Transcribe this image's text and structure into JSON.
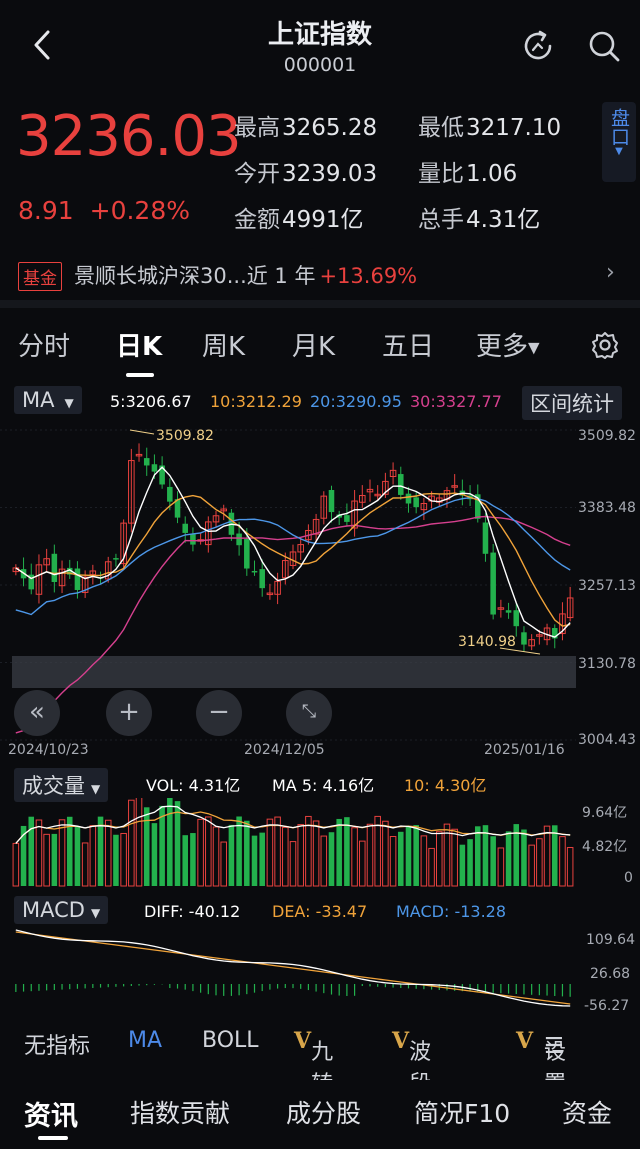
{
  "header": {
    "title": "上证指数",
    "code": "000001"
  },
  "quote": {
    "price": "3236.03",
    "change": "8.91",
    "change_pct": "+0.28%",
    "high_label": "最高",
    "high": "3265.28",
    "low_label": "最低",
    "low": "3217.10",
    "open_label": "今开",
    "open": "3239.03",
    "vol_ratio_label": "量比",
    "vol_ratio": "1.06",
    "amount_label": "金额",
    "amount": "4991亿",
    "turnover_label": "总手",
    "turnover": "4.31亿",
    "pankou": "盘口"
  },
  "fund": {
    "badge": "基金",
    "name": "景顺长城沪深30...近 1 年",
    "ret": "+13.69%"
  },
  "tabs": [
    "分时",
    "日K",
    "周K",
    "月K",
    "五日",
    "更多"
  ],
  "ma_bar": {
    "selector": "MA",
    "ma5": "5:3206.67",
    "ma10": "10:3212.29",
    "ma20": "20:3290.95",
    "ma30": "30:3327.77",
    "stats_button": "区间统计"
  },
  "kline": {
    "y_ticks": [
      "3509.82",
      "3383.48",
      "3257.13",
      "3130.78",
      "3004.43"
    ],
    "x_ticks": [
      "2024/10/23",
      "2024/12/05",
      "2025/01/16"
    ],
    "high_mark": "3509.82",
    "low_mark": "3140.98"
  },
  "volume_bar": {
    "selector": "成交量",
    "vol": "VOL: 4.31亿",
    "ma5": "MA 5: 4.16亿",
    "ma10": "10: 4.30亿",
    "y_ticks": [
      "9.64亿",
      "4.82亿",
      "0"
    ]
  },
  "macd_bar": {
    "selector": "MACD",
    "diff": "DIFF: -40.12",
    "dea": "DEA: -33.47",
    "macd": "MACD: -13.28",
    "y_ticks": [
      "109.64",
      "26.68",
      "-56.27"
    ]
  },
  "indicators": [
    "无指标",
    "MA",
    "BOLL",
    "九转",
    "波段王",
    "设置"
  ],
  "bottom_tabs": [
    "资讯",
    "指数贡献",
    "成分股",
    "简况F10",
    "资金"
  ],
  "colors": {
    "up": "#e8413e",
    "down": "#23b14d",
    "ma5": "#ffffff",
    "ma10": "#f0a33a",
    "ma20": "#4d97e8",
    "ma30": "#d5408e",
    "accent": "#4d8ae8"
  },
  "chart_data": {
    "type": "candlestick",
    "series_name": "上证指数 日K",
    "ylim": [
      3004.43,
      3509.82
    ],
    "closes": [
      3285,
      3268,
      3250,
      3290,
      3300,
      3262,
      3283,
      3274,
      3249,
      3270,
      3280,
      3269,
      3295,
      3300,
      3358,
      3460,
      3470,
      3452,
      3442,
      3421,
      3393,
      3367,
      3342,
      3323,
      3331,
      3360,
      3370,
      3381,
      3339,
      3322,
      3284,
      3279,
      3252,
      3244,
      3263,
      3297,
      3311,
      3323,
      3346,
      3364,
      3402,
      3376,
      3367,
      3360,
      3394,
      3403,
      3413,
      3405,
      3426,
      3444,
      3404,
      3390,
      3384,
      3390,
      3402,
      3399,
      3411,
      3419,
      3403,
      3397,
      3365,
      3308,
      3209,
      3220,
      3212,
      3190,
      3160,
      3168,
      3176,
      3187,
      3170,
      3210,
      3236
    ]
  }
}
